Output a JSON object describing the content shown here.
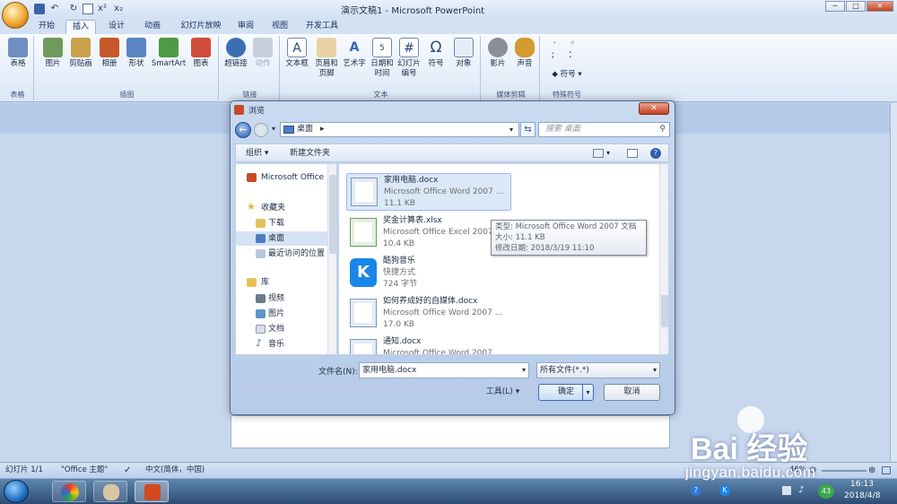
{
  "app": {
    "title": "演示文稿1 - Microsoft PowerPoint",
    "qat_icons": [
      "save-icon",
      "undo-icon",
      "redo-icon",
      "print-preview-icon",
      "superscript-icon",
      "subscript-icon"
    ],
    "window_controls": [
      "─",
      "□",
      "✕"
    ]
  },
  "tabs": [
    "开始",
    "插入",
    "设计",
    "动画",
    "幻灯片放映",
    "审阅",
    "视图",
    "开发工具"
  ],
  "active_tab": "插入",
  "ribbon": {
    "groups": [
      {
        "label": "表格",
        "buttons": [
          "表格"
        ]
      },
      {
        "label": "插图",
        "buttons": [
          "图片",
          "剪贴画",
          "相册",
          "形状",
          "SmartArt",
          "图表"
        ]
      },
      {
        "label": "链接",
        "buttons": [
          "超链接",
          "动作"
        ]
      },
      {
        "label": "文本",
        "buttons": [
          "文本框",
          "页眉和\n页脚",
          "艺术字",
          "日期和\n时间",
          "幻灯片\n编号",
          "符号",
          "对象"
        ]
      },
      {
        "label": "媒体剪辑",
        "buttons": [
          "影片",
          "声音"
        ]
      },
      {
        "label": "特殊符号",
        "buttons": [
          "符号"
        ]
      }
    ]
  },
  "dialog": {
    "title": "浏览",
    "address": "桌面",
    "address_arrow": "▸",
    "search_placeholder": "搜索 桌面",
    "organize": "组织 ▾",
    "new_folder": "新建文件夹",
    "nav": [
      {
        "label": "Microsoft Office",
        "icon": "office-icon",
        "selected": false
      },
      {
        "label": "收藏夹",
        "icon": "star-icon",
        "selected": false
      },
      {
        "label": "下载",
        "icon": "folder-icon",
        "selected": false
      },
      {
        "label": "桌面",
        "icon": "desktop-icon",
        "selected": true
      },
      {
        "label": "最近访问的位置",
        "icon": "recent-icon",
        "selected": false
      },
      {
        "label": "库",
        "icon": "library-icon",
        "selected": false
      },
      {
        "label": "视频",
        "icon": "video-icon",
        "selected": false
      },
      {
        "label": "图片",
        "icon": "picture-icon",
        "selected": false
      },
      {
        "label": "文档",
        "icon": "document-icon",
        "selected": false
      },
      {
        "label": "音乐",
        "icon": "music-icon",
        "selected": false
      }
    ],
    "files": [
      {
        "name": "家用电脑.docx",
        "type": "Microsoft Office Word 2007 ...",
        "size": "11.1 KB",
        "icon": "word-file-icon",
        "selected": true
      },
      {
        "name": "奖金计算表.xlsx",
        "type": "Microsoft Office Excel 2007 ...",
        "size": "10.4 KB",
        "icon": "excel-file-icon",
        "selected": false
      },
      {
        "name": "酷狗音乐",
        "type": "快捷方式",
        "size": "724 字节",
        "icon": "kugou-shortcut-icon",
        "selected": false
      },
      {
        "name": "如何养成好的自媒体.docx",
        "type": "Microsoft Office Word 2007 ...",
        "size": "17.0 KB",
        "icon": "word-file-icon",
        "selected": false
      },
      {
        "name": "通知.docx",
        "type": "Microsoft Office Word 2007 ...",
        "size": "",
        "icon": "word-file-icon",
        "selected": false
      }
    ],
    "tooltip": {
      "type": "类型: Microsoft Office Word 2007 文档",
      "size": "大小: 11.1 KB",
      "modified": "修改日期: 2018/3/19 11:10"
    },
    "filename_label": "文件名(N):",
    "filename_value": "家用电脑.docx",
    "filetype_value": "所有文件(*.*)",
    "tools_label": "工具(L)",
    "ok_label": "确定",
    "cancel_label": "取消"
  },
  "status": {
    "slide": "幻灯片 1/1",
    "theme": "\"Office 主题\"",
    "lang": "中文(简体，中国)",
    "zoom": "46%"
  },
  "taskbar": {
    "time": "16:13",
    "date": "2018/4/8",
    "badge": "43"
  },
  "watermark": {
    "text": "Bai 经验",
    "url": "jingyan.baidu.com"
  }
}
